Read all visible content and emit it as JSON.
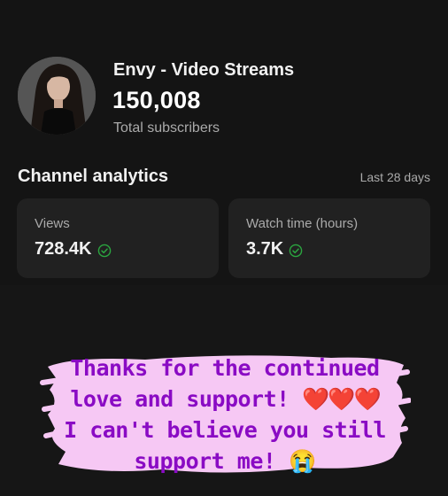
{
  "channel": {
    "name": "Envy - Video Streams",
    "subscriber_count": "150,008",
    "subscriber_label": "Total subscribers"
  },
  "analytics": {
    "title": "Channel analytics",
    "period": "Last 28 days",
    "cards": [
      {
        "label": "Views",
        "value": "728.4K",
        "status_icon": "check-circle-icon"
      },
      {
        "label": "Watch time (hours)",
        "value": "3.7K",
        "status_icon": "check-circle-icon"
      }
    ]
  },
  "sticker": {
    "line1": "Thanks for the continued",
    "line2": "love and support!",
    "line2_hearts": "❤️❤️❤️",
    "line3": "I can't believe you still",
    "line4": "support me!",
    "line4_emoji": "😭"
  },
  "colors": {
    "background": "#0f0f0f",
    "card": "#212121",
    "check": "#2ba640",
    "sticker_text": "#8a0bc4",
    "sticker_bg": "#f6c8f4"
  }
}
